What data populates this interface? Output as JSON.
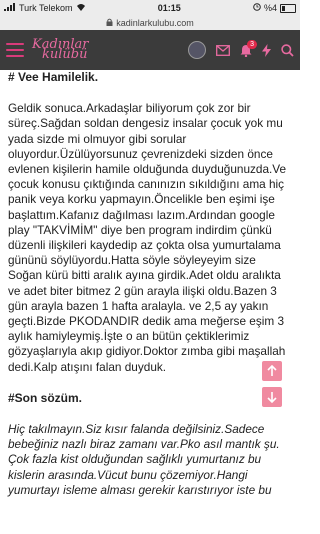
{
  "status": {
    "carrier": "Turk Telekom",
    "time": "01:15",
    "battery": "%4"
  },
  "url": {
    "domain": "kadinlarkulubu.com"
  },
  "logo": {
    "line1": "Kadınlar",
    "line2": "kulübü"
  },
  "header": {
    "notif_count": "3"
  },
  "post": {
    "heading1": "# Vee Hamilelik.",
    "para1": "Geldik sonuca.Arkadaşlar biliyorum çok zor bir süreç.Sağdan soldan dengesiz insalar çocuk yok mu yada sizde mi olmuyor gibi sorular oluyordur.Üzülüyorsunuz çevrenizdeki sizden önce evlenen kişilerin hamile olduğunda duyduğunuzda.Ve çocuk konusu çıktığında canınızın sıkıldığını ama hiç panik veya korku yapmayın.Öncelikle ben eşimi işe başlattım.Kafanız dağılması lazım.Ardından google play \"TAKVİMİM\" diye ben program indirdim çünkü düzenli ilişkileri kaydedip az çokta olsa yumurtalama gününü söylüyordu.Hatta söyle söyleyeyim size Soğan kürü bitti aralık ayına girdik.Adet oldu aralıkta ve adet biter bitmez 2 gün arayla ilişki oldu.Bazen 3 gün arayla bazen 1 hafta aralayla. ve 2,5 ay yakın geçti.Bizde PKODANDIR dedik ama meğerse eşim 3 aylık hamiyleymiş.İşte o an bütün çektiklerimiz gözyaşlarıyla akıp gidiyor.Doktor zımba gibi maşallah dedi.Kalp atışını falan duyduk.",
    "heading2": "#Son sözüm.",
    "para2": "Hiç takılmayın.Siz kısır falanda değilsiniz.Sadece bebeğiniz nazlı biraz zamanı var.Pko asıl mantık şu. Çok fazla kist olduğundan sağlıklı yumurtanız bu kislerin arasında.Vücut bunu çözemiyor.Hangi yumurtayı isleme alması gerekir karıstırıyor iste bu"
  },
  "colors": {
    "header_bg": "#3b3b3b",
    "accent": "#e86aa0",
    "scroll_btn": "#f08aa0"
  }
}
